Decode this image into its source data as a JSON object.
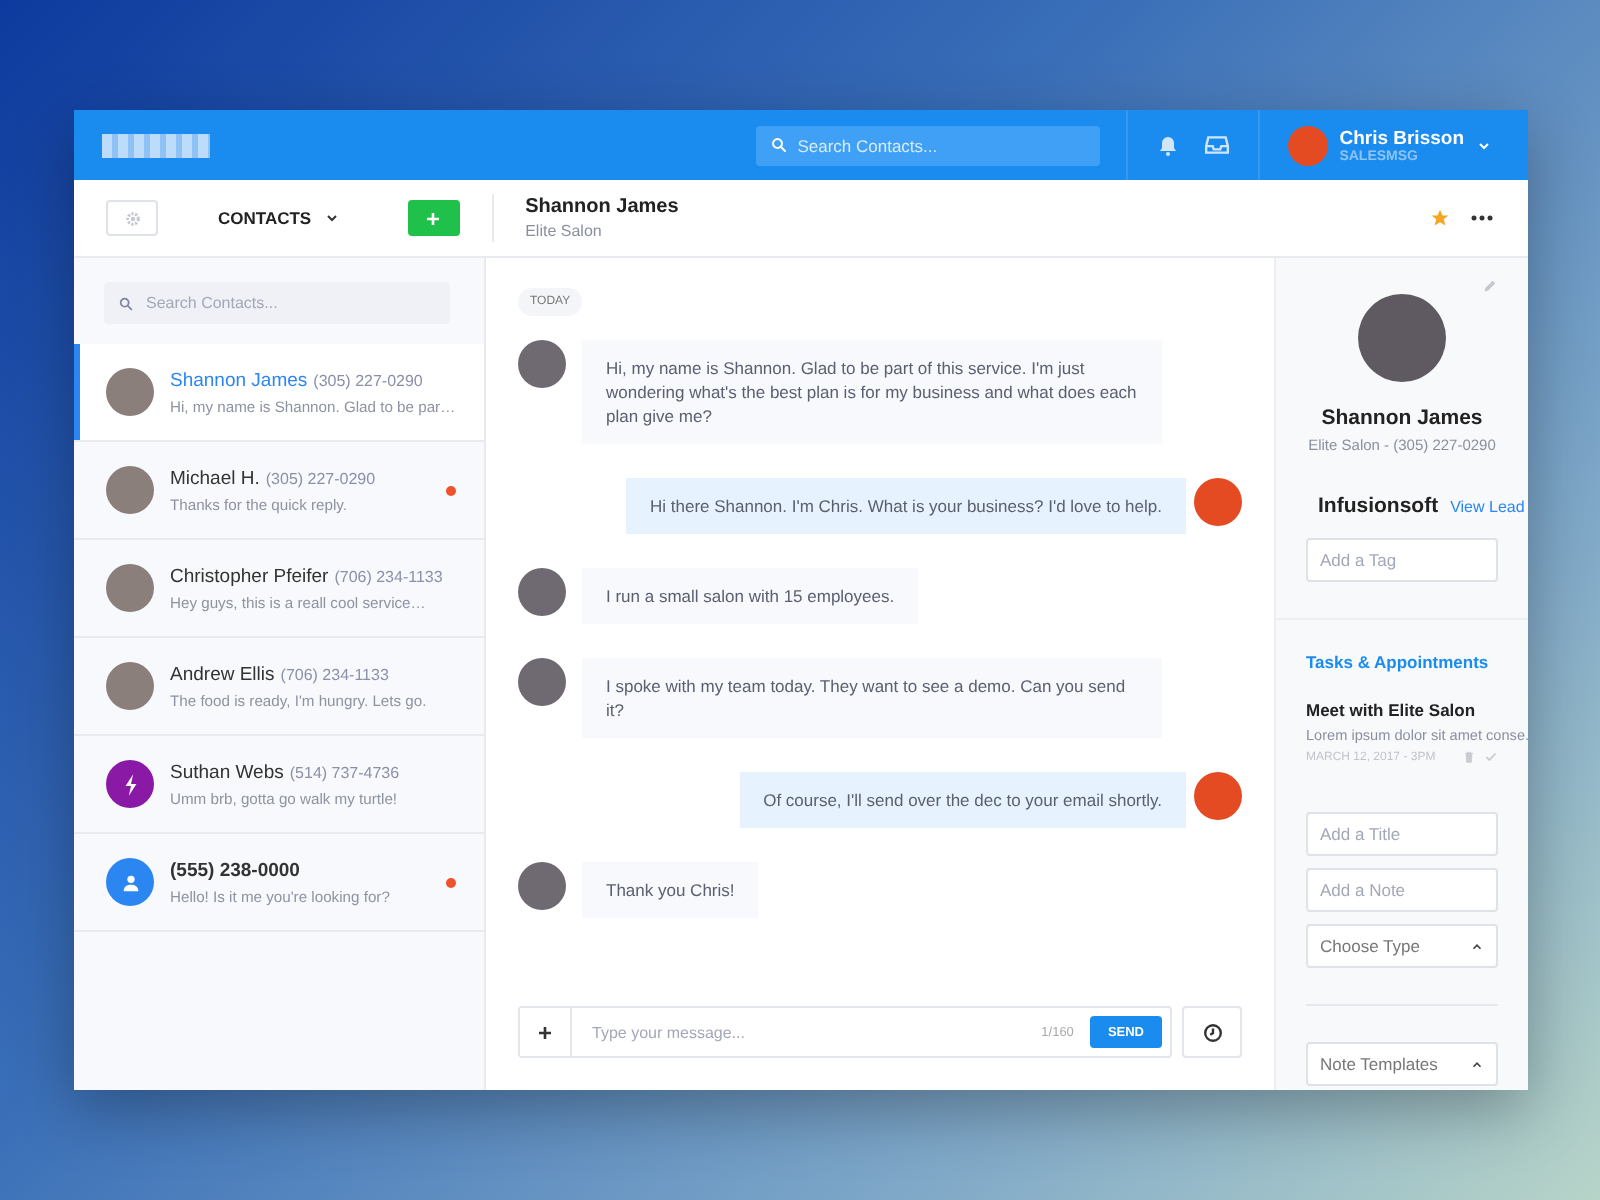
{
  "header": {
    "search_placeholder": "Search Contacts...",
    "user": {
      "name": "Chris Brisson",
      "company": "SALESMSG"
    }
  },
  "toolbar": {
    "section": "CONTACTS",
    "contact_name": "Shannon James",
    "contact_company": "Elite Salon",
    "starred": true
  },
  "contacts": {
    "search_placeholder": "Search Contacts...",
    "items": [
      {
        "kind": "photo",
        "name": "Shannon James",
        "phone": "(305) 227-0290",
        "preview": "Hi, my name is Shannon. Glad to be par…",
        "selected": true,
        "unread": false
      },
      {
        "kind": "photo",
        "name": "Michael H.",
        "phone": "(305) 227-0290",
        "preview": "Thanks for the quick reply.",
        "selected": false,
        "unread": true
      },
      {
        "kind": "photo",
        "name": "Christopher Pfeifer",
        "phone": "(706) 234-1133",
        "preview": "Hey guys, this is a reall cool service…",
        "selected": false,
        "unread": false
      },
      {
        "kind": "photo",
        "name": "Andrew Ellis",
        "phone": "(706) 234-1133",
        "preview": "The food is ready, I'm hungry. Lets go.",
        "selected": false,
        "unread": false
      },
      {
        "kind": "logo",
        "name": "Suthan Webs",
        "phone": "(514) 737-4736",
        "preview": "Umm brb, gotta go walk my turtle!",
        "selected": false,
        "unread": false
      },
      {
        "kind": "generic",
        "name": "(555) 238-0000",
        "preview": "Hello! Is it me you're looking for?",
        "selected": false,
        "unread": true
      }
    ]
  },
  "chat": {
    "date": "TODAY",
    "messages": [
      {
        "kind": "incoming",
        "text": "Hi, my name is Shannon. Glad to be part of this service. I'm just wondering what's the best plan  is for my business and what does each plan give me?"
      },
      {
        "kind": "outgoing",
        "text": "Hi there Shannon. I'm Chris. What is your business? I'd love to help."
      },
      {
        "kind": "incoming",
        "text": "I run a small salon with 15 employees."
      },
      {
        "kind": "incoming",
        "text": "I spoke with my team today. They want to see a demo. Can you send it?"
      },
      {
        "kind": "outgoing",
        "text": "Of course, I'll send over the dec to your email shortly."
      },
      {
        "kind": "incoming",
        "text": "Thank you Chris!"
      }
    ]
  },
  "composer": {
    "placeholder": "Type your message...",
    "counter": "1/160",
    "send": "SEND"
  },
  "details": {
    "name": "Shannon James",
    "subtitle": "Elite Salon - (305) 227-0290",
    "integration": {
      "name": "Infusionsoft",
      "link": "View Lead"
    },
    "tag_placeholder": "Add a Tag",
    "tasks_title": "Tasks & Appointments",
    "tasks": [
      {
        "title": "Meet with Elite Salon",
        "description": "Lorem ipsum dolor sit amet conse.",
        "date": "MARCH 12, 2017 - 3PM"
      }
    ],
    "title_placeholder": "Add a Title",
    "note_placeholder": "Add a Note",
    "type_select": "Choose Type",
    "templates_select": "Note Templates"
  }
}
